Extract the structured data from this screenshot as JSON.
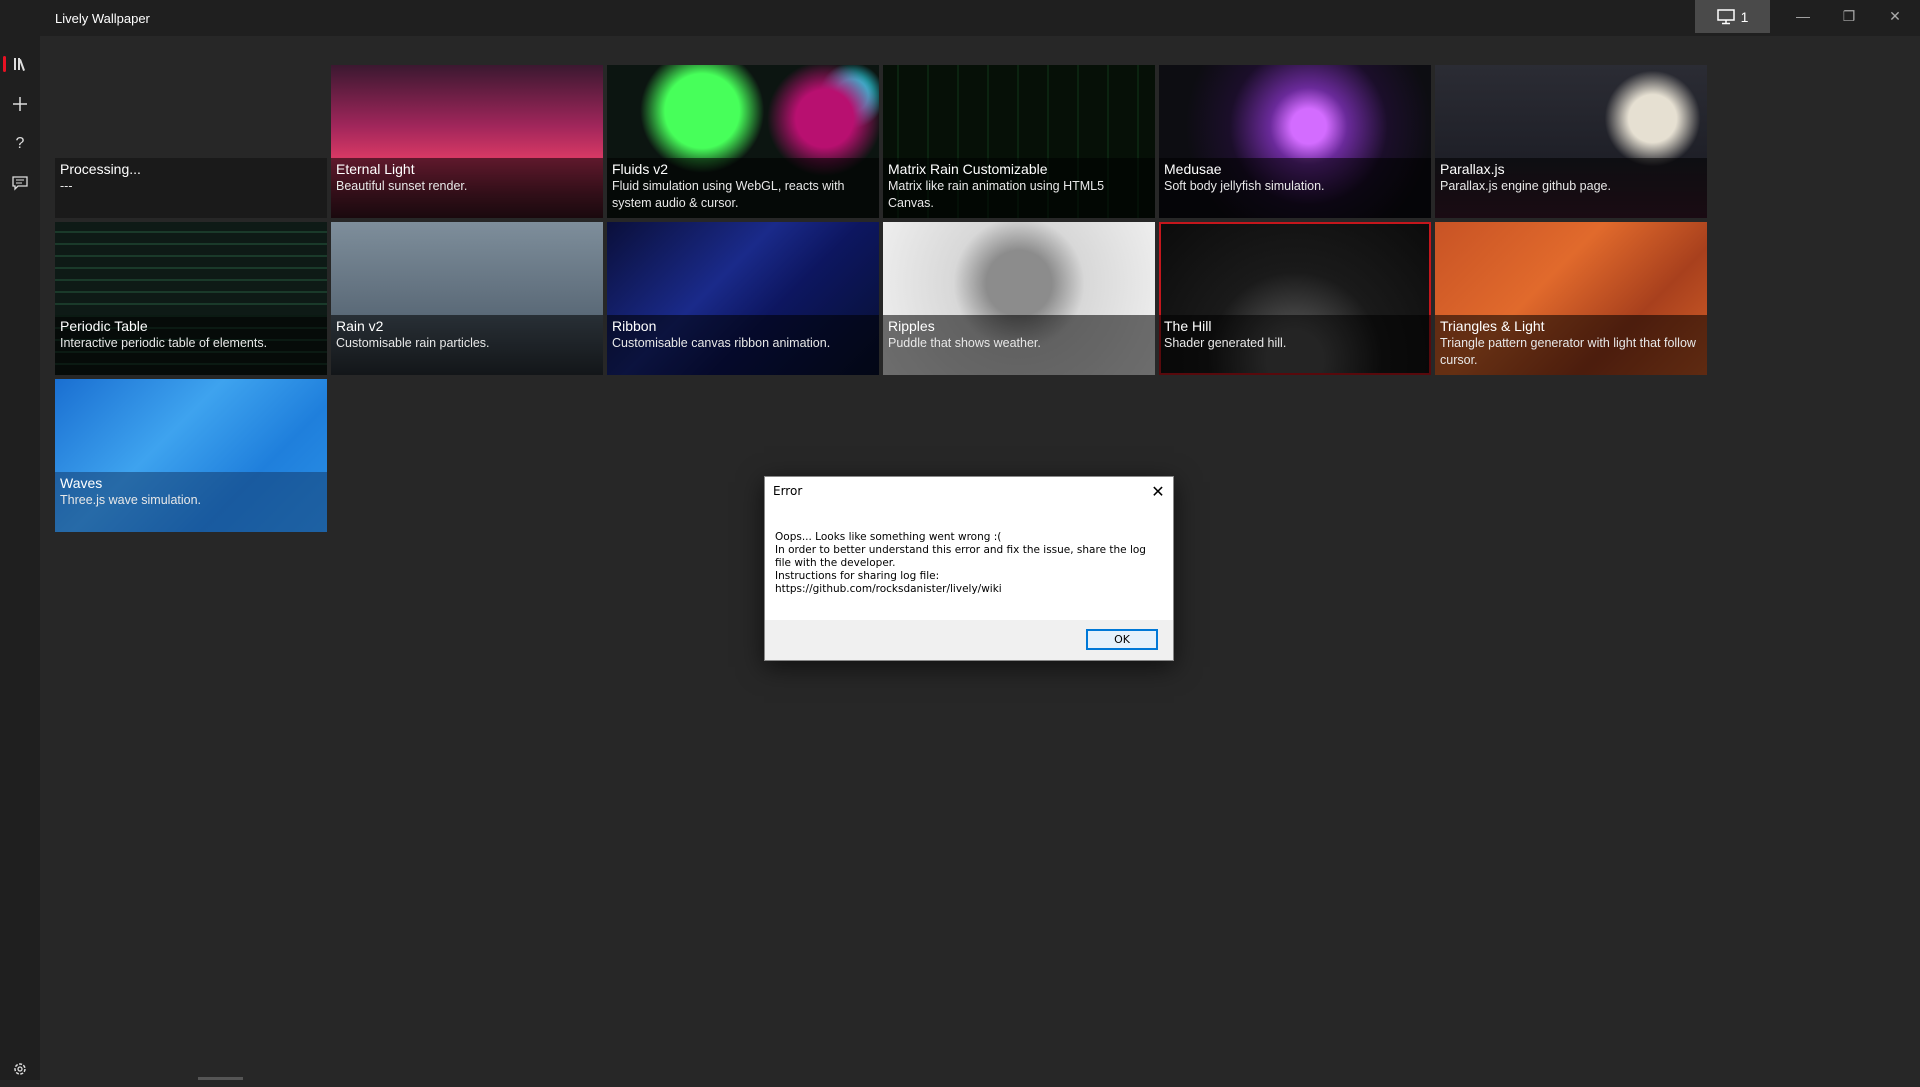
{
  "window": {
    "title": "Lively Wallpaper",
    "monitor_count": "1",
    "controls": {
      "minimize": "—",
      "restore": "❐",
      "close": "✕"
    }
  },
  "sidebar": {
    "items": [
      {
        "name": "library",
        "icon": "library-icon",
        "glyph": "Ⅱ∕",
        "active": true
      },
      {
        "name": "add",
        "icon": "plus-icon",
        "glyph": "+"
      },
      {
        "name": "help",
        "icon": "question-icon",
        "glyph": "?"
      },
      {
        "name": "feedback",
        "icon": "chat-icon",
        "glyph": "☰"
      }
    ],
    "settings_icon": "gear-icon"
  },
  "library": {
    "tiles": [
      {
        "title": "Processing...",
        "desc": "---",
        "style": "processing"
      },
      {
        "title": "Eternal Light",
        "desc": "Beautiful sunset render.",
        "style": "eternal"
      },
      {
        "title": "Fluids v2",
        "desc": "Fluid simulation using WebGL, reacts with system audio & cursor.",
        "style": "fluids"
      },
      {
        "title": "Matrix Rain Customizable",
        "desc": "Matrix like rain animation using HTML5 Canvas.",
        "style": "matrix"
      },
      {
        "title": "Medusae",
        "desc": "Soft body jellyfish simulation.",
        "style": "medusae"
      },
      {
        "title": "Parallax.js",
        "desc": "Parallax.js engine github page.",
        "style": "parallax"
      },
      {
        "title": "Periodic Table",
        "desc": "Interactive periodic table of elements.",
        "style": "periodic"
      },
      {
        "title": "Rain v2",
        "desc": "Customisable rain particles.",
        "style": "rain"
      },
      {
        "title": "Ribbon",
        "desc": "Customisable canvas ribbon animation.",
        "style": "ribbon"
      },
      {
        "title": "Ripples",
        "desc": "Puddle that shows weather.",
        "style": "ripples"
      },
      {
        "title": "The Hill",
        "desc": "Shader generated hill.",
        "style": "hill",
        "selected": true
      },
      {
        "title": "Triangles & Light",
        "desc": "Triangle pattern generator with light that follow cursor.",
        "style": "triangles"
      },
      {
        "title": "Waves",
        "desc": "Three.js wave simulation.",
        "style": "waves"
      }
    ]
  },
  "dialog": {
    "title": "Error",
    "lines": [
      "Oops... Looks like something went wrong :(",
      "In order to better understand this error and fix the issue, share the log",
      "file with the developer.",
      "Instructions for sharing log file:",
      "https://github.com/rocksdanister/lively/wiki"
    ],
    "ok_label": "OK"
  },
  "colors": {
    "accent": "#e81123",
    "selected_border": "#c4161c",
    "background": "#272727"
  }
}
